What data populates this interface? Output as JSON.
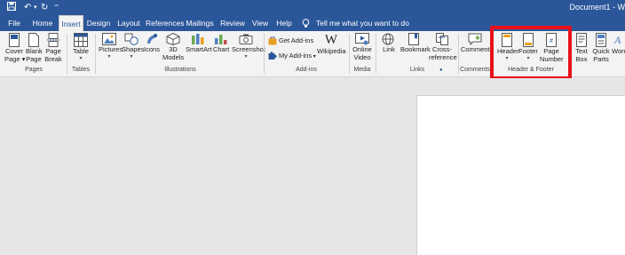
{
  "app": {
    "document_title": "Document1 - W",
    "quick_access": {
      "undo_symbol": "↶",
      "redo_symbol": "↻",
      "customize_symbol": "⁼"
    }
  },
  "tabs": [
    {
      "label": "File"
    },
    {
      "label": "Home"
    },
    {
      "label": "Insert",
      "active": true
    },
    {
      "label": "Design"
    },
    {
      "label": "Layout"
    },
    {
      "label": "References"
    },
    {
      "label": "Mailings"
    },
    {
      "label": "Review"
    },
    {
      "label": "View"
    },
    {
      "label": "Help"
    }
  ],
  "tell_me": {
    "placeholder": "Tell me what you want to do",
    "icon": "lightbulb-icon"
  },
  "ribbon": {
    "pages": {
      "name": "Pages",
      "cover_page": "Cover Page",
      "blank_page": "Blank Page",
      "page_break": "Page Break"
    },
    "tables": {
      "name": "Tables",
      "table": "Table"
    },
    "illustrations": {
      "name": "Illustrations",
      "pictures": "Pictures",
      "shapes": "Shapes",
      "icons": "Icons",
      "models_3d_line1": "3D",
      "models_3d_line2": "Models",
      "smartart": "SmartArt",
      "chart": "Chart",
      "screenshot": "Screenshot"
    },
    "addins": {
      "name": "Add-ins",
      "get_addins": "Get Add-ins",
      "my_addins": "My Add-ins",
      "wikipedia": "Wikipedia"
    },
    "media": {
      "name": "Media",
      "online_video_line1": "Online",
      "online_video_line2": "Video"
    },
    "links": {
      "name": "Links",
      "link": "Link",
      "bookmark": "Bookmark",
      "cross_ref_line1": "Cross-",
      "cross_ref_line2": "reference"
    },
    "comments": {
      "name": "Comments",
      "comment": "Comment"
    },
    "header_footer": {
      "name": "Header & Footer",
      "header": "Header",
      "footer": "Footer",
      "page_number_line1": "Page",
      "page_number_line2": "Number"
    },
    "text": {
      "text_box_line1": "Text",
      "text_box_line2": "Box",
      "quick_parts_line1": "Quick",
      "quick_parts_line2": "Parts",
      "wordart": "Word"
    }
  },
  "highlight_color": "#e8101a",
  "accent_color": "#2b579a"
}
